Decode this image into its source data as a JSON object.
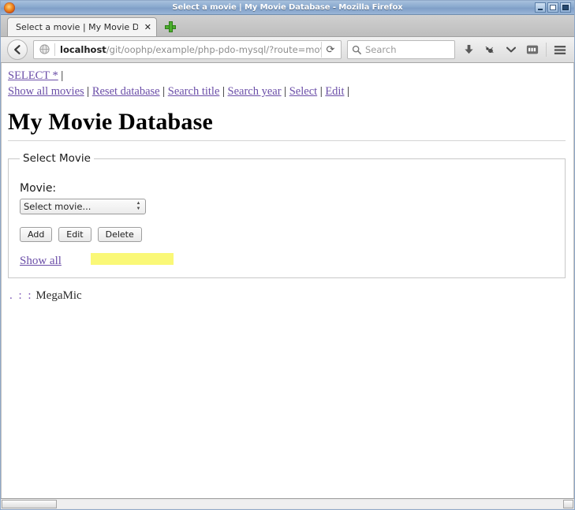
{
  "window": {
    "title": "Select a movie | My Movie Database - Mozilla Firefox",
    "app_icon": "firefox-logo-icon",
    "controls": {
      "minimize": "minimize-button",
      "maximize": "maximize-button",
      "close": "close-button"
    }
  },
  "browser": {
    "tab": {
      "label": "Select a movie | My Movie D...",
      "close_glyph": "✕"
    },
    "new_tab_label": "+",
    "toolbar": {
      "back_glyph": "←",
      "url_host": "localhost",
      "url_path": "/git/oophp/example/php-pdo-mysql/?route=movie-sel",
      "url_full": "localhost/git/oophp/example/php-pdo-mysql/?route=movie-sel",
      "reload_glyph": "⟳",
      "search_placeholder": "Search",
      "download_glyph": "⬇",
      "chevron_glyph": "⌄",
      "menu_glyph": "☰"
    }
  },
  "page": {
    "top_nav": {
      "select_star": "SELECT *",
      "separator": "|",
      "links": [
        "Show all movies",
        "Reset database",
        "Search title",
        "Search year",
        "Select",
        "Edit"
      ]
    },
    "title": "My Movie Database",
    "fieldset": {
      "legend": "Select Movie",
      "movie_label": "Movie:",
      "select_value": "Select movie...",
      "buttons": [
        "Add",
        "Edit",
        "Delete"
      ],
      "show_all_link": "Show all",
      "highlight_color": "#faf877"
    },
    "footer": {
      "dots": ". : :",
      "text": "MegaMic"
    },
    "link_color": "#6b4ea8"
  }
}
